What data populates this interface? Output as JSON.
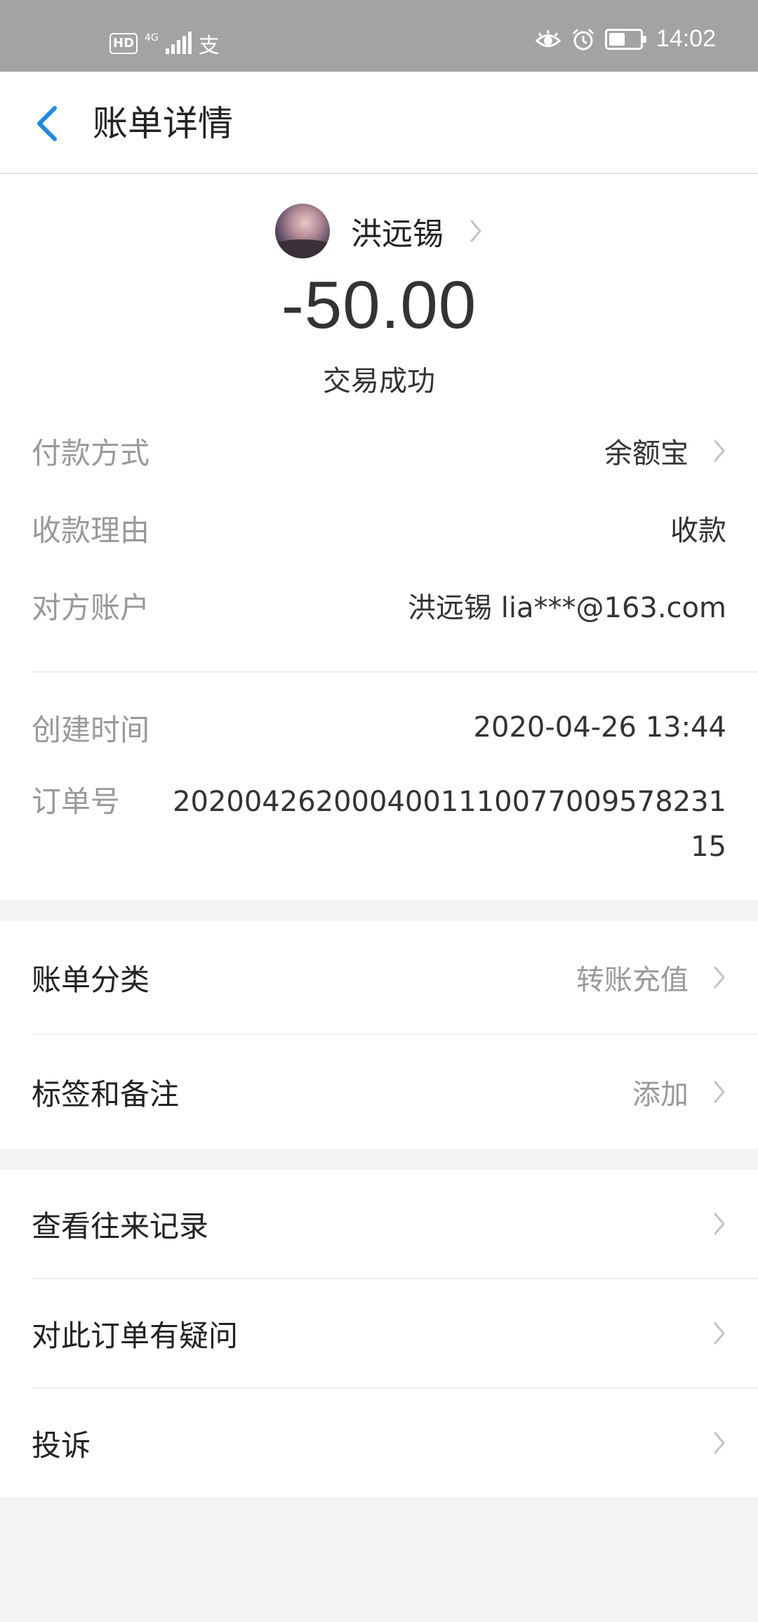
{
  "status_bar": {
    "hd_label": "HD",
    "network_label": "4G",
    "app_glyph": "支",
    "time": "14:02",
    "icons": [
      "eye-icon",
      "alarm-icon",
      "battery-icon"
    ]
  },
  "nav": {
    "title": "账单详情",
    "back_icon": "chevron-left-icon"
  },
  "summary": {
    "counterparty_name": "洪远锡",
    "amount": "-50.00",
    "status": "交易成功"
  },
  "details": {
    "payment_method": {
      "label": "付款方式",
      "value": "余额宝"
    },
    "reason": {
      "label": "收款理由",
      "value": "收款"
    },
    "account": {
      "label": "对方账户",
      "value": "洪远锡 lia***@163.com"
    },
    "created_time": {
      "label": "创建时间",
      "value": "2020-04-26 13:44"
    },
    "order_no": {
      "label": "订单号",
      "line1": "2020042620004001110077009578231",
      "line2": "15"
    }
  },
  "category_menu": {
    "category": {
      "label": "账单分类",
      "value": "转账充值"
    },
    "tags": {
      "label": "标签和备注",
      "value": "添加"
    }
  },
  "actions_menu": {
    "history": {
      "label": "查看往来记录"
    },
    "question": {
      "label": "对此订单有疑问"
    },
    "complain": {
      "label": "投诉"
    }
  },
  "colors": {
    "accent": "#1E88E5",
    "status_bar_bg": "#A3A3A3",
    "page_bg": "#F4F4F4",
    "muted_text": "#999999",
    "primary_text": "#333333"
  }
}
